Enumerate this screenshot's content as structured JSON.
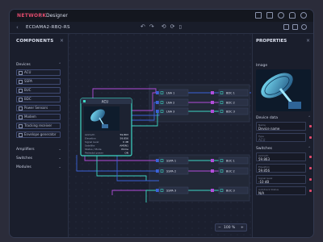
{
  "titlebar": {
    "brand": "NETWORK",
    "separator": "/",
    "app_name": "Designer"
  },
  "toolbar": {
    "back_icon": "chevron-left-icon",
    "document_title": "ECDAMA2-RBQ-RS"
  },
  "components": {
    "heading": "COMPONENTS",
    "devices_label": "Devices",
    "items": [
      {
        "label": "ACU",
        "icon": "dish-icon"
      },
      {
        "label": "SSPA",
        "icon": "amplifier-icon"
      },
      {
        "label": "BUC",
        "icon": "converter-icon"
      },
      {
        "label": "BDC",
        "icon": "converter-icon"
      },
      {
        "label": "Power Sensors",
        "icon": "sensor-icon"
      },
      {
        "label": "Modem",
        "icon": "modem-icon"
      },
      {
        "label": "Tracking receiver",
        "icon": "receiver-icon"
      },
      {
        "label": "Envelope generator",
        "icon": "generator-icon"
      }
    ],
    "sections": [
      "Amplifiers",
      "Switches",
      "Modules"
    ]
  },
  "acu_node": {
    "title": "ACU",
    "rows": [
      {
        "label": "Azimuth",
        "value": "59.863"
      },
      {
        "label": "Elevation",
        "value": "59.856"
      },
      {
        "label": "Signal level",
        "value": "0 dB"
      },
      {
        "label": "Satellite",
        "value": "AMSN1"
      },
      {
        "label": "Status / Mode",
        "value": "Prime"
      },
      {
        "label": "Pedestal power",
        "value": "ON"
      }
    ]
  },
  "links": [
    {
      "label": "LNA 1"
    },
    {
      "label": "LNA 2"
    },
    {
      "label": "LNA 3"
    },
    {
      "label": "SSPA 1"
    },
    {
      "label": "SSPA 2"
    },
    {
      "label": "SSPA 3"
    }
  ],
  "bdcs": [
    {
      "label": "BDC 1"
    },
    {
      "label": "BDC 2"
    },
    {
      "label": "BDC 3"
    },
    {
      "label": "BUC 1"
    },
    {
      "label": "BUC 2"
    },
    {
      "label": "BUC 3"
    }
  ],
  "zoom": {
    "minus": "−",
    "value": "100 %",
    "plus": "+"
  },
  "properties": {
    "heading": "PROPERTIES",
    "image_label": "Image",
    "device_data_label": "Device data",
    "name_label": "Name",
    "name_value": "Device name",
    "type_label": "Type",
    "type_value": "ACU",
    "switches_label": "Switches",
    "fields": [
      {
        "label": "Azimuth",
        "value": "59.863"
      },
      {
        "label": "Elevation",
        "value": "59.856"
      },
      {
        "label": "Signal level",
        "value": "-10 dB"
      },
      {
        "label": "Autotrack Status",
        "value": "N/A"
      }
    ]
  },
  "colors": {
    "accent_teal": "#3ed6c4",
    "accent_pink": "#e14b6c",
    "accent_blue": "#3b62d8",
    "accent_purple": "#b24ddb"
  }
}
